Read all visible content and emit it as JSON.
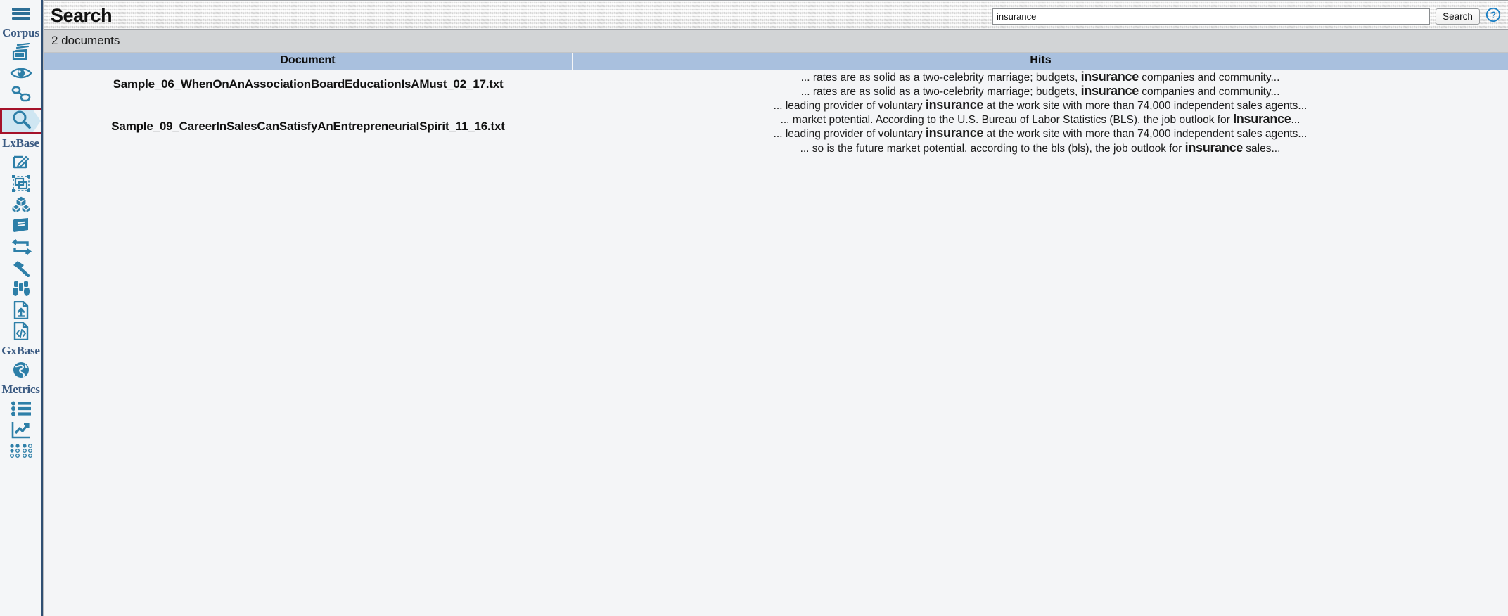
{
  "sidebar": {
    "menu_icon": "hamburger-menu-icon",
    "groups": [
      {
        "label": "Corpus",
        "items": [
          {
            "icon": "documents-stack-icon",
            "name": "corpus-documents"
          },
          {
            "icon": "eye-icon",
            "name": "corpus-view"
          },
          {
            "icon": "link-chain-icon",
            "name": "corpus-links"
          },
          {
            "icon": "search-magnifier-icon",
            "name": "corpus-search",
            "selected": true
          }
        ]
      },
      {
        "label": "LxBase",
        "items": [
          {
            "icon": "pencil-edit-icon",
            "name": "lxbase-edit"
          },
          {
            "icon": "frames-select-icon",
            "name": "lxbase-frames"
          },
          {
            "icon": "cubes-icon",
            "name": "lxbase-cubes"
          },
          {
            "icon": "book-icon",
            "name": "lxbase-lexicon"
          },
          {
            "icon": "refresh-sync-icon",
            "name": "lxbase-sync"
          },
          {
            "icon": "hammer-icon",
            "name": "lxbase-build"
          },
          {
            "icon": "binoculars-icon",
            "name": "lxbase-explore"
          },
          {
            "icon": "file-upload-icon",
            "name": "lxbase-import"
          },
          {
            "icon": "file-code-icon",
            "name": "lxbase-code"
          }
        ]
      },
      {
        "label": "GxBase",
        "items": [
          {
            "icon": "globe-icon",
            "name": "gxbase-globe"
          }
        ]
      },
      {
        "label": "Metrics",
        "items": [
          {
            "icon": "list-bullets-icon",
            "name": "metrics-list"
          },
          {
            "icon": "chart-trend-icon",
            "name": "metrics-chart"
          },
          {
            "icon": "dots-matrix-icon",
            "name": "metrics-matrix"
          }
        ]
      }
    ]
  },
  "header": {
    "title": "Search",
    "search_value": "insurance",
    "search_placeholder": "",
    "search_button": "Search",
    "help_icon": "question-circle-icon"
  },
  "status": {
    "document_count_text": "2 documents"
  },
  "table": {
    "columns": [
      "Document",
      "Hits"
    ],
    "rows": [
      {
        "document": "Sample_06_WhenOnAnAssociationBoardEducationIsAMust_02_17.txt",
        "hits": [
          {
            "pre": "... rates are as solid as a two-celebrity marriage; budgets, ",
            "term": "insurance",
            "post": " companies and community..."
          },
          {
            "pre": "... rates are as solid as a two-celebrity marriage; budgets, ",
            "term": "insurance",
            "post": " companies and community..."
          }
        ]
      },
      {
        "document": "Sample_09_CareerInSalesCanSatisfyAnEntrepreneurialSpirit_11_16.txt",
        "hits": [
          {
            "pre": "... leading provider of voluntary ",
            "term": "insurance",
            "post": " at the work site with more than 74,000 independent sales agents..."
          },
          {
            "pre": "... market potential. According to the U.S. Bureau of Labor Statistics (BLS), the job outlook for ",
            "term": "Insurance",
            "post": "..."
          },
          {
            "pre": "... leading provider of voluntary ",
            "term": "insurance",
            "post": " at the work site with more than 74,000 independent sales agents..."
          },
          {
            "pre": "... so is the future market potential. according to the bls (bls), the job outlook for ",
            "term": "insurance",
            "post": " sales..."
          }
        ]
      }
    ]
  },
  "colors": {
    "sidebar_icon": "#2d7fa8",
    "sidebar_label": "#3a5a82",
    "selection_border": "#a5122a",
    "selection_fill": "#cfe6f2",
    "table_header": "#a9c0de",
    "status_bar": "#d2d4d6"
  }
}
